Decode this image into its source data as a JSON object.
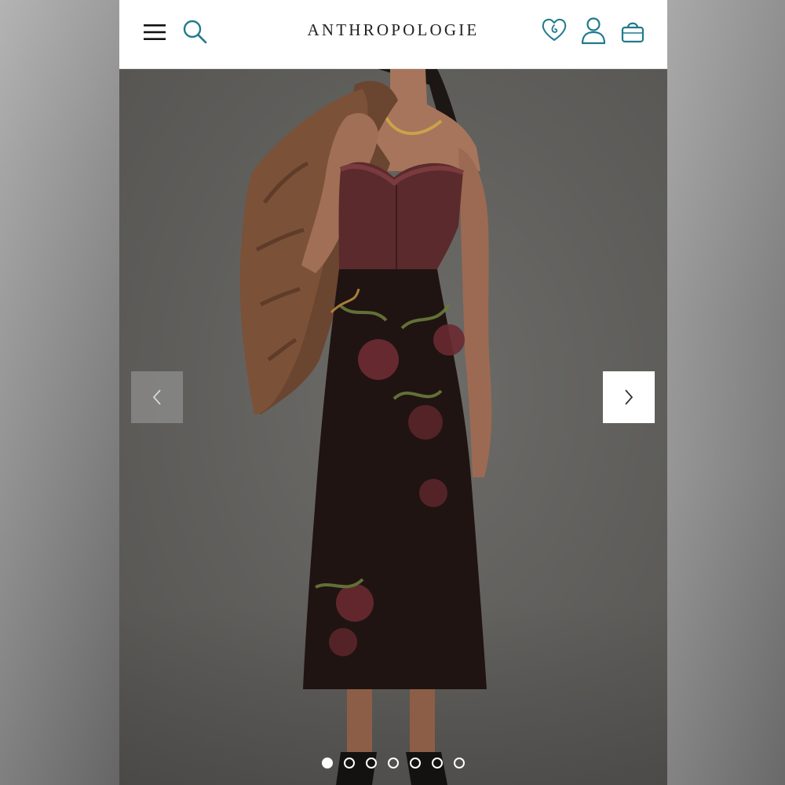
{
  "header": {
    "logo": "ANTHROPOLOGIE",
    "icons": {
      "menu": "hamburger-menu-icon",
      "search": "search-icon",
      "wishlist": "heart-icon",
      "account": "user-icon",
      "bag": "shopping-bag-icon"
    }
  },
  "colors": {
    "accent": "#1f7a8c",
    "header_bg": "#ffffff",
    "logo_text": "#222222"
  },
  "gallery": {
    "image_count": 7,
    "active_index": 0,
    "prev_icon": "chevron-left-icon",
    "next_icon": "chevron-right-icon"
  }
}
